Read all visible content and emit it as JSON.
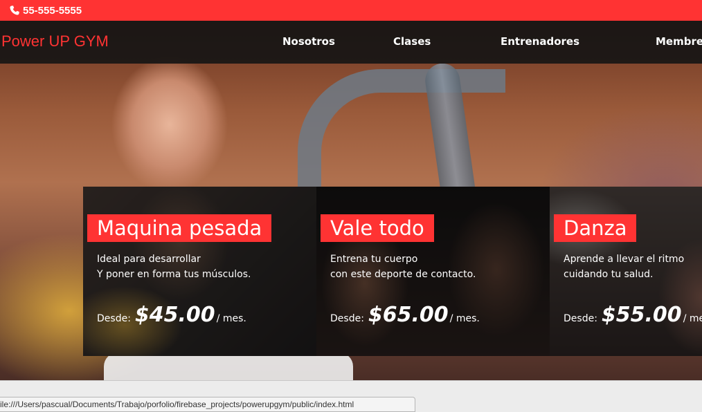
{
  "topbar": {
    "phone_icon": "phone-icon",
    "phone": "55-555-5555",
    "color": "#ff3333"
  },
  "nav": {
    "brand": "Power UP GYM",
    "links": [
      "Nosotros",
      "Clases",
      "Entrenadores",
      "Membres"
    ]
  },
  "cards": [
    {
      "title": "Maquina pesada",
      "desc_line1": "Ideal para desarrollar",
      "desc_line2": "Y poner en forma tus músculos.",
      "price_prefix": "Desde:",
      "price": "$45.00",
      "price_suffix": "/ mes."
    },
    {
      "title": "Vale todo",
      "desc_line1": "Entrena tu cuerpo",
      "desc_line2": "con este deporte de contacto.",
      "price_prefix": "Desde:",
      "price": "$65.00",
      "price_suffix": "/ mes."
    },
    {
      "title": "Danza",
      "desc_line1": "Aprende a llevar el ritmo",
      "desc_line2": "cuidando tu salud.",
      "price_prefix": "Desde:",
      "price": "$55.00",
      "price_suffix": "/ mes."
    }
  ],
  "status_bar": {
    "url": "ile:///Users/pascual/Documents/Trabajo/porfolio/firebase_projects/powerupgym/public/index.html"
  },
  "colors": {
    "accent": "#ff3333",
    "nav_bg": "#141414"
  }
}
